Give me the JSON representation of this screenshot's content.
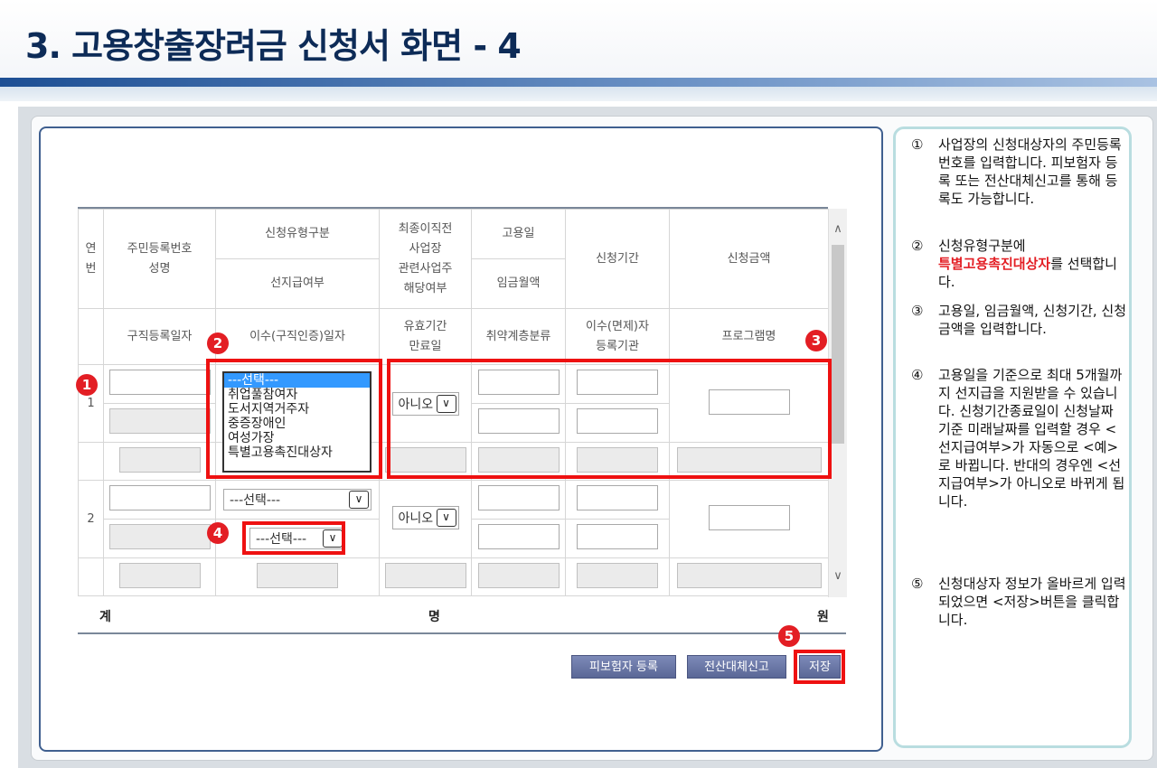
{
  "page_title": "3. 고용창출장려금 신청서 화면 - 4",
  "headers": {
    "col_no": "연번",
    "col_rrn": "주민등록번호",
    "col_name": "성명",
    "col_jobreg": "구직등록일자",
    "col_type": "신청유형구분",
    "col_prepay": "선지급여부",
    "col_complete": "이수(구직인증)일자",
    "col_last1": "최종이직전",
    "col_last2": "사업장",
    "col_last3": "관련사업주",
    "col_last4": "해당여부",
    "col_valid1": "유효기간",
    "col_valid2": "만료일",
    "col_hire": "고용일",
    "col_wage": "임금월액",
    "col_vuln": "취약계층분류",
    "col_period": "신청기간",
    "col_inst1": "이수(면제)자",
    "col_inst2": "등록기관",
    "col_amount": "신청금액",
    "col_program": "프로그램명"
  },
  "rows": [
    {
      "no": "1",
      "related": "아니오",
      "type_options": [
        "---선택---",
        "취업풀참여자",
        "도서지역거주자",
        "중증장애인",
        "여성가장",
        "특별고용촉진대상자"
      ]
    },
    {
      "no": "2",
      "related": "아니오",
      "type_value": "---선택---",
      "prepay_value": "---선택---"
    }
  ],
  "total": {
    "label": "계",
    "people_unit": "명",
    "amount_unit": "원"
  },
  "buttons": {
    "register": "피보험자 등록",
    "batch": "전산대체신고",
    "save": "저장"
  },
  "badges": [
    "1",
    "2",
    "3",
    "4",
    "5"
  ],
  "guide": [
    {
      "num": "①",
      "text": "사업장의 신청대상자의 주민등록번호를 입력합니다. 피보험자 등록 또는 전산대체신고를 통해 등록도 가능합니다."
    },
    {
      "num": "②",
      "pre": "신청유형구분에",
      "highlight": "특별고용촉진대상자",
      "post": "를 선택합니다."
    },
    {
      "num": "③",
      "text": "고용일, 임금월액, 신청기간, 신청금액을 입력합니다."
    },
    {
      "num": "④",
      "text": "고용일을 기준으로 최대 5개월까지 선지급을 지원받을 수 있습니다. 신청기간종료일이 신청날짜 기준 미래날짜를 입력할 경우 <선지급여부>가 자동으로 <예>로 바뀝니다. 반대의 경우엔 <선지급여부>가 아니오로 바뀌게 됩니다."
    },
    {
      "num": "⑤",
      "text": "신청대상자 정보가 올바르게 입력되었으면 <저장>버튼을 클릭합니다."
    }
  ],
  "colors": {
    "accent_red": "#e31e24",
    "title_navy": "#0d2b57",
    "button": "#6b78a6"
  }
}
